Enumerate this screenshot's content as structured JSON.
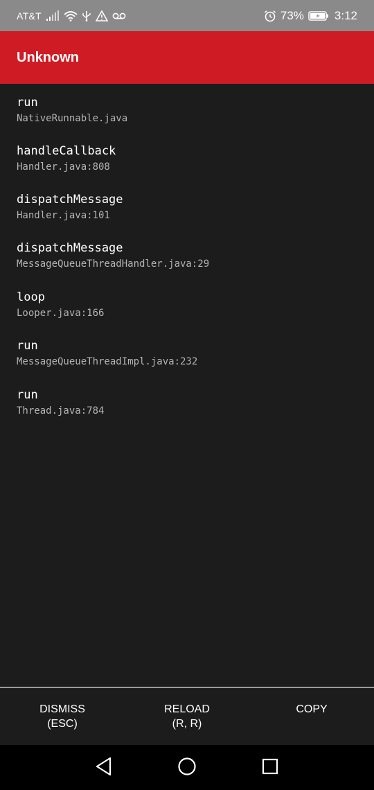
{
  "status_bar": {
    "carrier": "AT&T",
    "battery_percent": "73%",
    "time": "3:12",
    "icons": [
      "signal-icon",
      "wifi-icon",
      "usb-icon",
      "warning-icon",
      "voicemail-icon",
      "alarm-icon",
      "battery-charging-icon"
    ]
  },
  "header": {
    "title": "Unknown",
    "background": "#cf1b24"
  },
  "stack": [
    {
      "method": "run",
      "file": "NativeRunnable.java"
    },
    {
      "method": "handleCallback",
      "file": "Handler.java:808"
    },
    {
      "method": "dispatchMessage",
      "file": "Handler.java:101"
    },
    {
      "method": "dispatchMessage",
      "file": "MessageQueueThreadHandler.java:29"
    },
    {
      "method": "loop",
      "file": "Looper.java:166"
    },
    {
      "method": "run",
      "file": "MessageQueueThreadImpl.java:232"
    },
    {
      "method": "run",
      "file": "Thread.java:784"
    }
  ],
  "actions": {
    "dismiss": {
      "label": "DISMISS",
      "shortcut": "(ESC)"
    },
    "reload": {
      "label": "RELOAD",
      "shortcut": "(R, R)"
    },
    "copy": {
      "label": "COPY"
    }
  },
  "nav_bar": {
    "icons": [
      "back-icon",
      "home-icon",
      "recents-icon"
    ]
  }
}
